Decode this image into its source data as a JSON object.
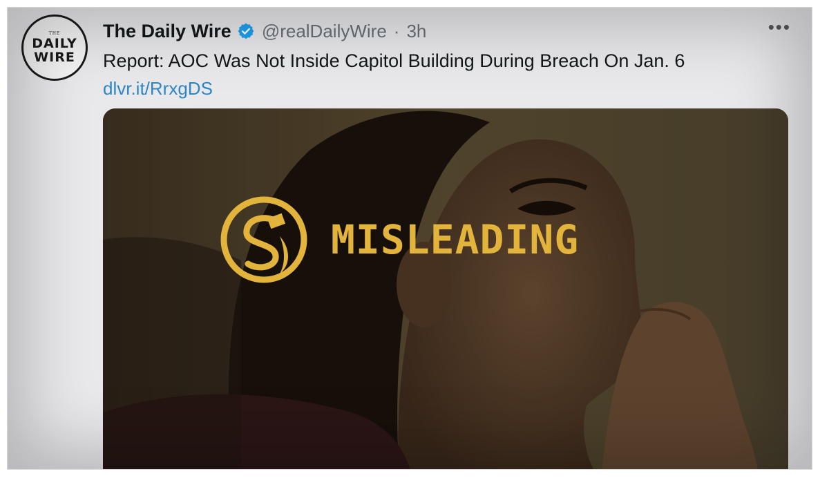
{
  "tweet": {
    "avatar": {
      "small_text": "THE",
      "line1": "DAILY",
      "line2": "WIRE"
    },
    "display_name": "The Daily Wire",
    "verified_icon": "verified-badge-icon",
    "handle": "@realDailyWire",
    "separator": "·",
    "time": "3h",
    "more_icon": "more-options-icon",
    "more_label": "•••",
    "text": "Report: AOC Was Not Inside Capitol Building During Breach On Jan. 6",
    "link": "dlvr.it/RrxgDS",
    "media": {
      "overlay_icon": "misleading-flag-icon",
      "overlay_label": "MISLEADING"
    }
  },
  "colors": {
    "link": "#2d86c6",
    "verified": "#1da1f2",
    "misleading": "#e3b43c",
    "name": "#14171a",
    "muted": "#6b7077"
  }
}
